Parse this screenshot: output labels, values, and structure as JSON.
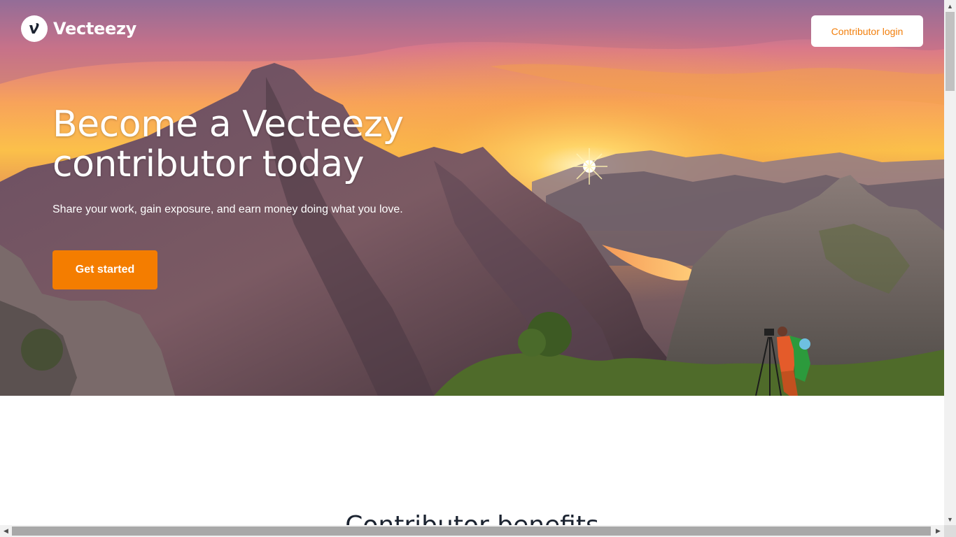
{
  "header": {
    "brand_name": "Vecteezy",
    "logo_icon": "vecteezy-v-logo",
    "login_label": "Contributor login"
  },
  "hero": {
    "title": "Become a Vecteezy contributor today",
    "subtitle": "Share your work, gain exposure, and earn money doing what you love.",
    "cta_label": "Get started",
    "background_image": "mountain-sunset-photographer"
  },
  "benefits": {
    "title": "Contributor benefits"
  },
  "colors": {
    "accent": "#f47d00",
    "login_text": "#f27f0c",
    "heading_dark": "#1b2330"
  }
}
